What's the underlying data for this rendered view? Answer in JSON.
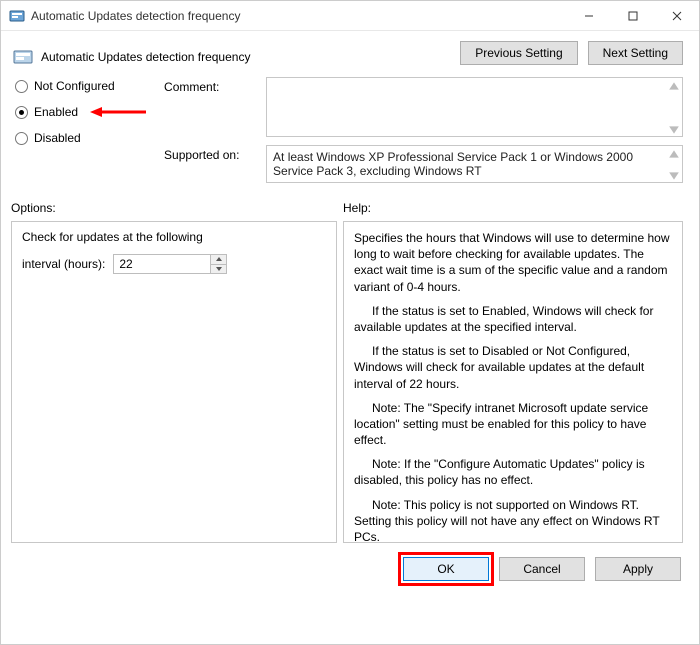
{
  "window": {
    "title": "Automatic Updates detection frequency"
  },
  "header": {
    "policy_name": "Automatic Updates detection frequency",
    "prev_btn": "Previous Setting",
    "next_btn": "Next Setting"
  },
  "state": {
    "not_configured": "Not Configured",
    "enabled": "Enabled",
    "disabled": "Disabled",
    "selected": "Enabled"
  },
  "comment": {
    "label": "Comment:",
    "value": ""
  },
  "supported": {
    "label": "Supported on:",
    "text": "At least Windows XP Professional Service Pack 1 or Windows 2000 Service Pack 3, excluding Windows RT"
  },
  "sections": {
    "options_label": "Options:",
    "help_label": "Help:"
  },
  "options": {
    "line1": "Check for updates at the following",
    "interval_label": "interval (hours):",
    "interval_value": "22"
  },
  "help": {
    "p1": "Specifies the hours that Windows will use to determine how long to wait before checking for available updates. The exact wait time is a sum of the specific value and a random variant of 0-4 hours.",
    "p2": "If the status is set to Enabled, Windows will check for available updates at the specified interval.",
    "p3": "If the status is set to Disabled or Not Configured, Windows will check for available updates at the default interval of 22 hours.",
    "p4": "Note: The \"Specify intranet Microsoft update service location\" setting must be enabled for this policy to have effect.",
    "p5": "Note: If the \"Configure Automatic Updates\" policy is disabled, this policy has no effect.",
    "p6": "Note: This policy is not supported on Windows RT. Setting this policy will not have any effect on Windows RT PCs."
  },
  "footer": {
    "ok": "OK",
    "cancel": "Cancel",
    "apply": "Apply"
  }
}
